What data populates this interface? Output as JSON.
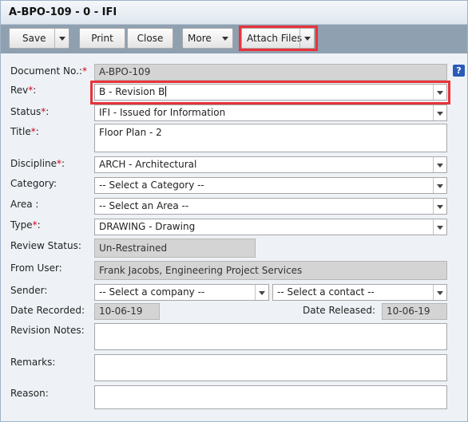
{
  "window": {
    "title": "A-BPO-109 - 0 - IFI"
  },
  "toolbar": {
    "save_label": "Save",
    "print_label": "Print",
    "close_label": "Close",
    "more_label": "More",
    "attach_label": "Attach Files"
  },
  "form": {
    "document_no": {
      "label": "Document No.:",
      "required": "*",
      "value": "A-BPO-109"
    },
    "rev": {
      "label": "Rev",
      "required": "*",
      "colon": ":",
      "value": "B - Revision B"
    },
    "status": {
      "label": "Status",
      "required": "*",
      "colon": ":",
      "value": "IFI - Issued for Information"
    },
    "title": {
      "label": "Title",
      "required": "*",
      "colon": ":",
      "value": "Floor Plan - 2"
    },
    "discipline": {
      "label": "Discipline",
      "required": "*",
      "colon": ":",
      "value": "ARCH - Architectural"
    },
    "category": {
      "label": "Category:",
      "value": "-- Select a Category --"
    },
    "area": {
      "label": "Area :",
      "value": "-- Select an Area --"
    },
    "type": {
      "label": "Type",
      "required": "*",
      "colon": ":",
      "value": "DRAWING - Drawing"
    },
    "review_status": {
      "label": "Review Status:",
      "value": "Un-Restrained"
    },
    "from_user": {
      "label": "From User:",
      "value": "Frank Jacobs, Engineering Project Services"
    },
    "sender": {
      "label": "Sender:",
      "company_value": "-- Select a company --",
      "contact_value": "-- Select a contact --"
    },
    "date_recorded": {
      "label": "Date Recorded:",
      "value": "10-06-19"
    },
    "date_released": {
      "label": "Date Released:",
      "value": "10-06-19"
    },
    "revision_notes": {
      "label": "Revision Notes:",
      "value": ""
    },
    "remarks": {
      "label": "Remarks:",
      "value": ""
    },
    "reason": {
      "label": "Reason:",
      "value": ""
    }
  },
  "help": {
    "glyph": "?"
  },
  "colors": {
    "highlight": "#e8333a",
    "required": "#d0021b",
    "toolbar": "#8fa0b0"
  }
}
